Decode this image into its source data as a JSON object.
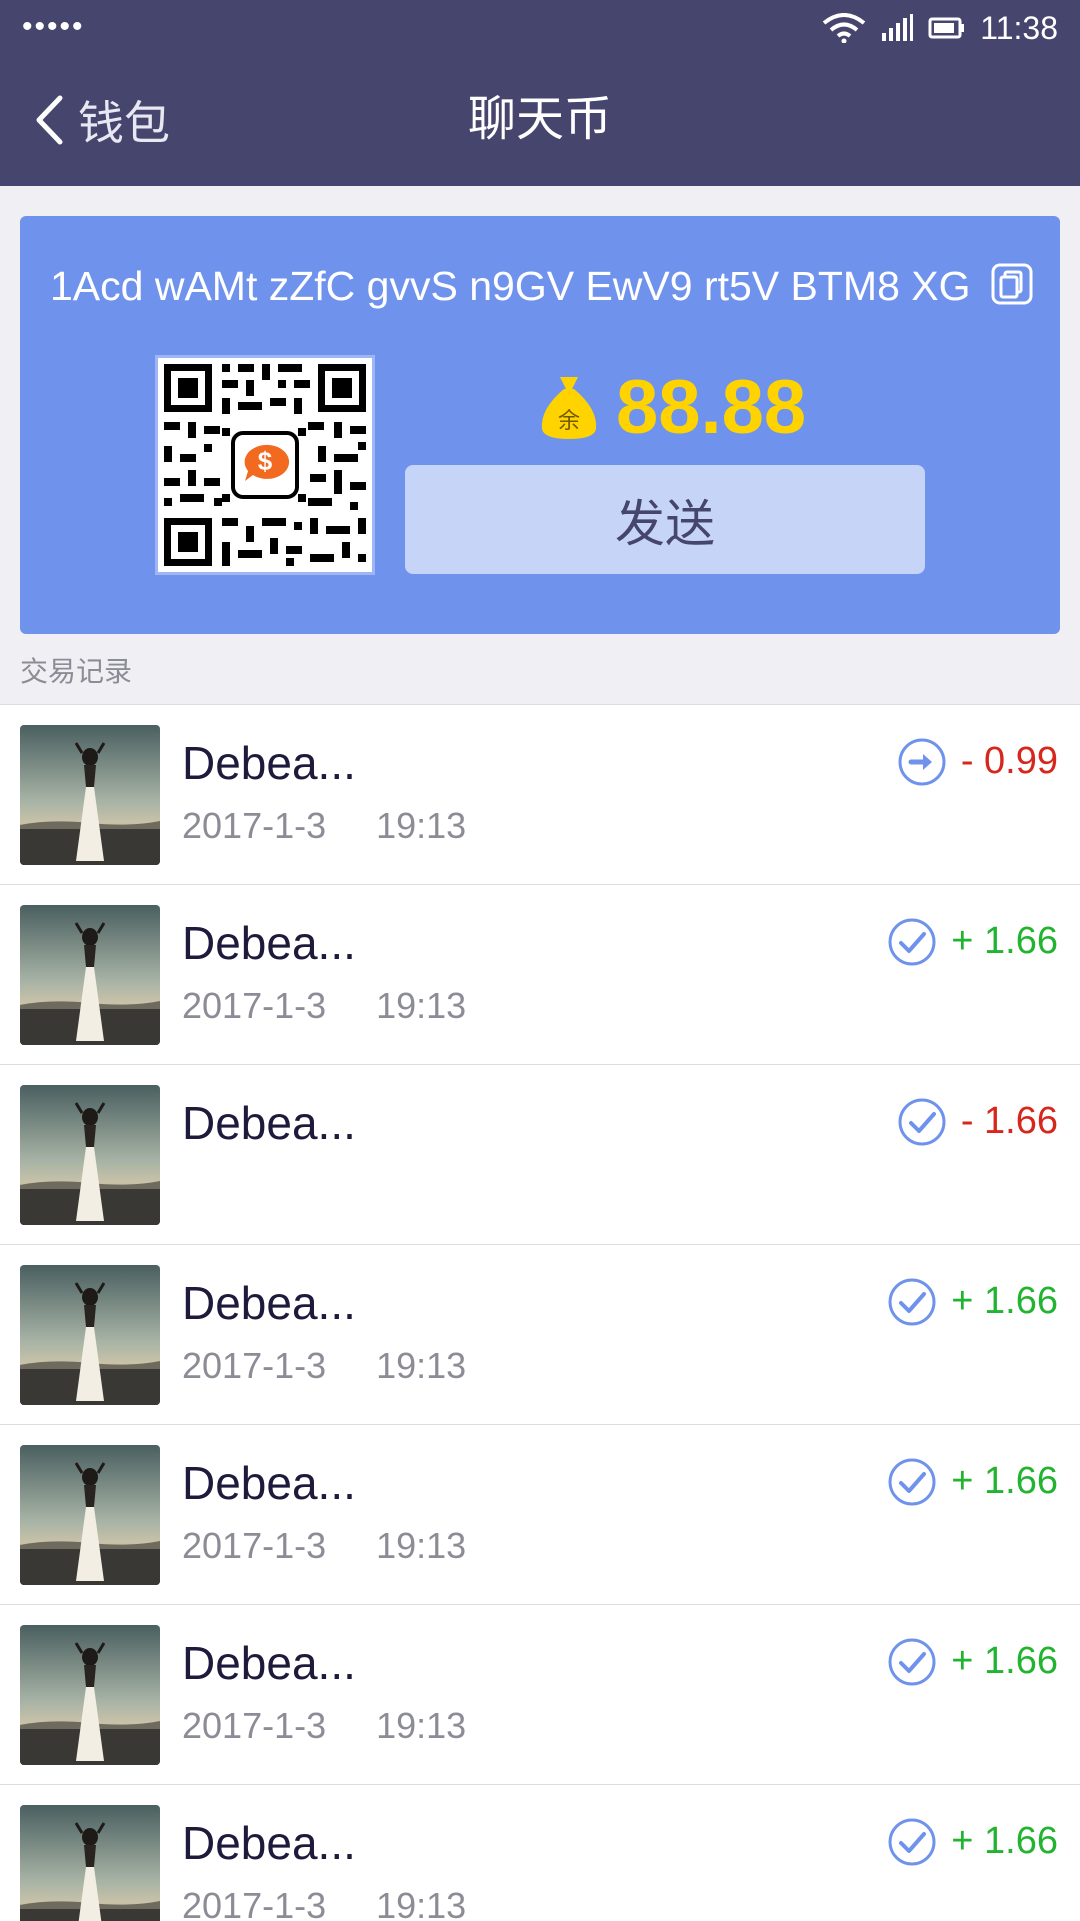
{
  "status_bar": {
    "signal": "•••••",
    "time": "11:38"
  },
  "nav": {
    "back_label": "钱包",
    "title": "聊天币"
  },
  "wallet": {
    "address": "1Acd wAMt zZfC gvvS n9GV EwV9 rt5V BTM8 XG",
    "balance_icon_text": "余",
    "balance": "88.88",
    "send_label": "发送",
    "qr_center_symbol": "$"
  },
  "section_label": "交易记录",
  "transactions": [
    {
      "name": "Debea...",
      "date": "2017-1-3",
      "time": "19:13",
      "status": "sent-arrow-icon",
      "amount": "- 0.99",
      "kind": "neg"
    },
    {
      "name": "Debea...",
      "date": "2017-1-3",
      "time": "19:13",
      "status": "check-circle-icon",
      "amount": "+ 1.66",
      "kind": "pos"
    },
    {
      "name": "Debea...",
      "date": "",
      "time": "",
      "status": "check-circle-icon",
      "amount": "- 1.66",
      "kind": "neg"
    },
    {
      "name": "Debea...",
      "date": "2017-1-3",
      "time": "19:13",
      "status": "check-circle-icon",
      "amount": "+ 1.66",
      "kind": "pos"
    },
    {
      "name": "Debea...",
      "date": "2017-1-3",
      "time": "19:13",
      "status": "check-circle-icon",
      "amount": "+ 1.66",
      "kind": "pos"
    },
    {
      "name": "Debea...",
      "date": "2017-1-3",
      "time": "19:13",
      "status": "check-circle-icon",
      "amount": "+ 1.66",
      "kind": "pos"
    },
    {
      "name": "Debea...",
      "date": "2017-1-3",
      "time": "19:13",
      "status": "check-circle-icon",
      "amount": "+ 1.66",
      "kind": "pos"
    }
  ],
  "colors": {
    "header": "#46456e",
    "card": "#6f93ed",
    "balance": "#ffd300",
    "negative": "#d7261b",
    "positive": "#22b430"
  }
}
